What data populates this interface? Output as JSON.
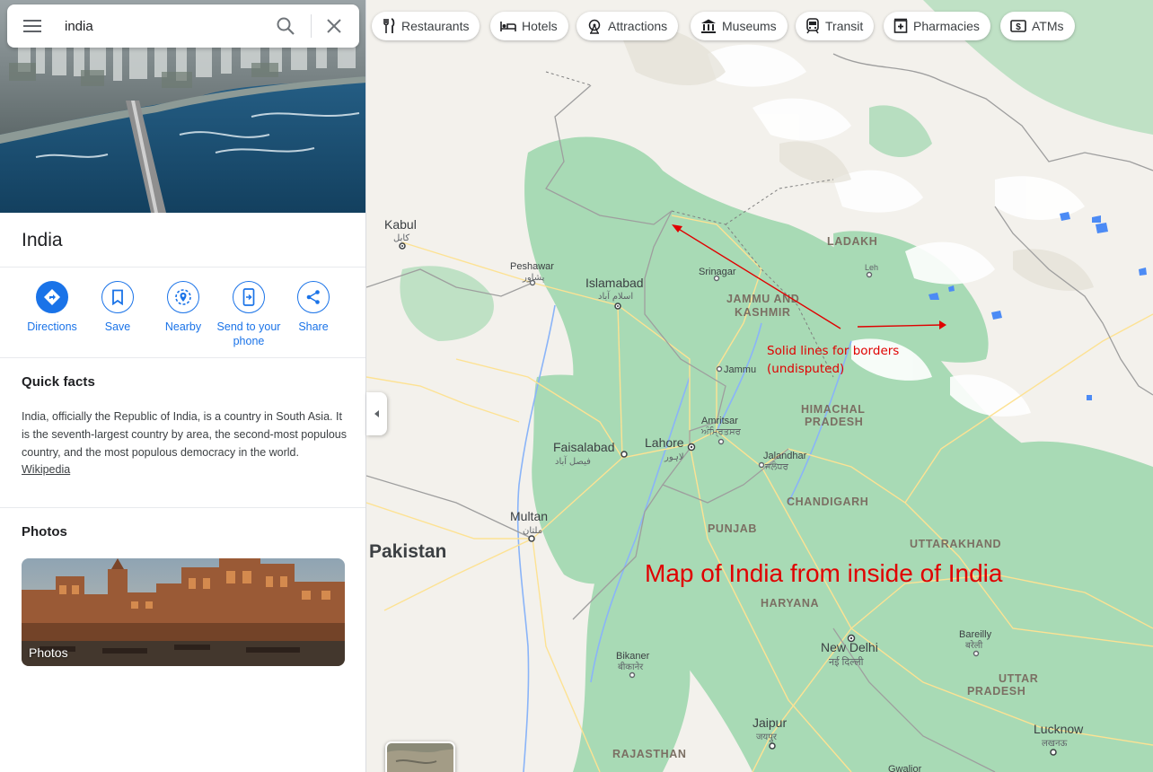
{
  "search": {
    "value": "india"
  },
  "place": {
    "title": "India"
  },
  "actions": [
    {
      "label": "Directions"
    },
    {
      "label": "Save"
    },
    {
      "label": "Nearby"
    },
    {
      "label": "Send to your phone"
    },
    {
      "label": "Share"
    }
  ],
  "quick_facts": {
    "title": "Quick facts",
    "text": "India, officially the Republic of India, is a country in South Asia. It is the seventh-largest country by area, the second-most populous country, and the most populous democracy in the world.",
    "link": "Wikipedia"
  },
  "photos": {
    "title": "Photos",
    "card_label": "Photos"
  },
  "chips": [
    {
      "label": "Restaurants",
      "icon": "fork-knife-icon"
    },
    {
      "label": "Hotels",
      "icon": "bed-icon"
    },
    {
      "label": "Attractions",
      "icon": "ferris-wheel-icon"
    },
    {
      "label": "Museums",
      "icon": "museum-icon"
    },
    {
      "label": "Transit",
      "icon": "train-icon"
    },
    {
      "label": "Pharmacies",
      "icon": "pharmacy-icon"
    },
    {
      "label": "ATMs",
      "icon": "atm-icon"
    }
  ],
  "map": {
    "country": "Pakistan",
    "regions": [
      "LADAKH",
      "JAMMU AND",
      "KASHMIR",
      "HIMACHAL",
      "PRADESH",
      "CHANDIGARH",
      "PUNJAB",
      "UTTARAKHAND",
      "HARYANA",
      "UTTAR",
      "PRADESH",
      "RAJASTHAN"
    ],
    "cities": {
      "kabul": {
        "name": "Kabul",
        "script": "کابل"
      },
      "peshawar": {
        "name": "Peshawar",
        "script": "پشاور"
      },
      "islamabad": {
        "name": "Islamabad",
        "script": "اسلام آباد"
      },
      "srinagar": {
        "name": "Srinagar"
      },
      "leh": {
        "name": "Leh"
      },
      "jammu": {
        "name": "Jammu"
      },
      "amritsar": {
        "name": "Amritsar",
        "script": "ਅੰਮ੍ਰਿਤਸਰ"
      },
      "faisalabad": {
        "name": "Faisalabad",
        "script": "فیصل آباد"
      },
      "lahore": {
        "name": "Lahore",
        "script": "لاہور"
      },
      "jalandhar": {
        "name": "Jalandhar",
        "script": "ਜਲੰਧਰ"
      },
      "multan": {
        "name": "Multan",
        "script": "ملتان"
      },
      "bareilly": {
        "name": "Bareilly",
        "script": "बरेली"
      },
      "new_delhi": {
        "name": "New Delhi",
        "script": "नई दिल्ली"
      },
      "bikaner": {
        "name": "Bikaner",
        "script": "बीकानेर"
      },
      "jaipur": {
        "name": "Jaipur",
        "script": "जयपुर"
      },
      "lucknow": {
        "name": "Lucknow",
        "script": "लखनऊ"
      },
      "gwalior": {
        "name": "Gwalior"
      }
    },
    "annotations": {
      "borders_line1": "Solid lines for borders",
      "borders_line2": "(undisputed)",
      "main": "Map of India from inside of India"
    },
    "colors": {
      "land": "#f3f1ec",
      "vegetation": "#a8dab5",
      "water": "#4c8bf5",
      "road": "#fde293",
      "annotation": "#e00000"
    }
  }
}
